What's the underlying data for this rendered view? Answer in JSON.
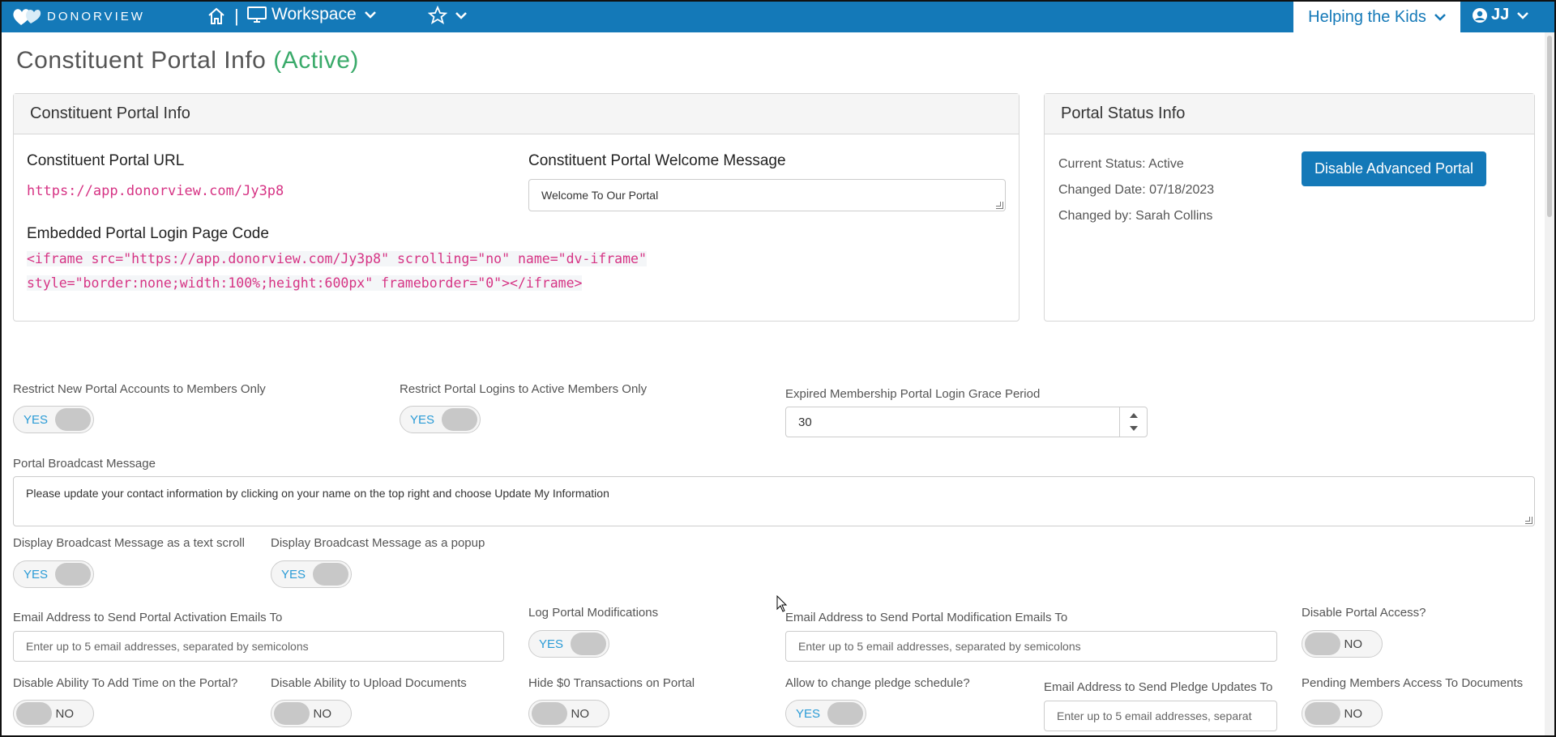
{
  "topbar": {
    "logo_text": "DONORVIEW",
    "separator": "|",
    "workspace_label": "Workspace",
    "org_label": "Helping the Kids",
    "user_initials": "JJ",
    "icons": [
      "heart-logo-icon",
      "home-icon",
      "monitor-icon",
      "chevron-down-icon",
      "star-icon",
      "user-circle-icon"
    ]
  },
  "page": {
    "title": "Constituent Portal Info",
    "status": "(Active)"
  },
  "info_panel": {
    "heading": "Constituent Portal Info",
    "url_label": "Constituent Portal URL",
    "url_value": "https://app.donorview.com/Jy3p8",
    "welcome_label": "Constituent Portal Welcome Message",
    "welcome_value": "Welcome To Our Portal",
    "embed_label": "Embedded Portal Login Page Code",
    "embed_line1": "<iframe src=\"https://app.donorview.com/Jy3p8\" scrolling=\"no\" name=\"dv-iframe\"",
    "embed_line2": "style=\"border:none;width:100%;height:600px\" frameborder=\"0\"></iframe>"
  },
  "status_panel": {
    "heading": "Portal Status Info",
    "current_status": "Current Status: Active",
    "changed_date": "Changed Date: 07/18/2023",
    "changed_by": "Changed by: Sarah Collins",
    "disable_button": "Disable Advanced Portal"
  },
  "settings": {
    "restrict_new_accounts": {
      "label": "Restrict New Portal Accounts to Members Only",
      "value": "YES"
    },
    "restrict_logins": {
      "label": "Restrict Portal Logins to Active Members Only",
      "value": "YES"
    },
    "grace_period": {
      "label": "Expired Membership Portal Login Grace Period",
      "value": "30"
    },
    "broadcast_message": {
      "label": "Portal Broadcast Message",
      "value": "Please update your contact information by clicking on your name on the top right and choose Update My Information"
    },
    "broadcast_scroll": {
      "label": "Display Broadcast Message as a text scroll",
      "value": "YES"
    },
    "broadcast_popup": {
      "label": "Display Broadcast Message as a popup",
      "value": "YES"
    },
    "activation_emails": {
      "label": "Email Address to Send Portal Activation Emails To",
      "placeholder": "Enter up to 5 email addresses, separated by semicolons"
    },
    "log_modifications": {
      "label": "Log Portal Modifications",
      "value": "YES"
    },
    "modification_emails": {
      "label": "Email Address to Send Portal Modification Emails To",
      "placeholder": "Enter up to 5 email addresses, separated by semicolons"
    },
    "disable_access": {
      "label": "Disable Portal Access?",
      "value": "NO"
    },
    "disable_add_time": {
      "label": "Disable Ability To Add Time on the Portal?",
      "value": "NO"
    },
    "disable_upload": {
      "label": "Disable Ability to Upload Documents",
      "value": "NO"
    },
    "hide_zero": {
      "label": "Hide $0 Transactions on Portal",
      "value": "NO"
    },
    "change_pledge": {
      "label": "Allow to change pledge schedule?",
      "value": "YES"
    },
    "pledge_emails": {
      "label": "Email Address to Send Pledge Updates To",
      "placeholder": "Enter up to 5 email addresses, separat"
    },
    "pending_docs": {
      "label": "Pending Members Access To Documents",
      "value": "NO"
    }
  },
  "colors": {
    "brand_blue": "#1479b8",
    "active_green": "#3aaa6a",
    "code_pink": "#d63384",
    "toggle_yes_text": "#2a9bd6"
  }
}
